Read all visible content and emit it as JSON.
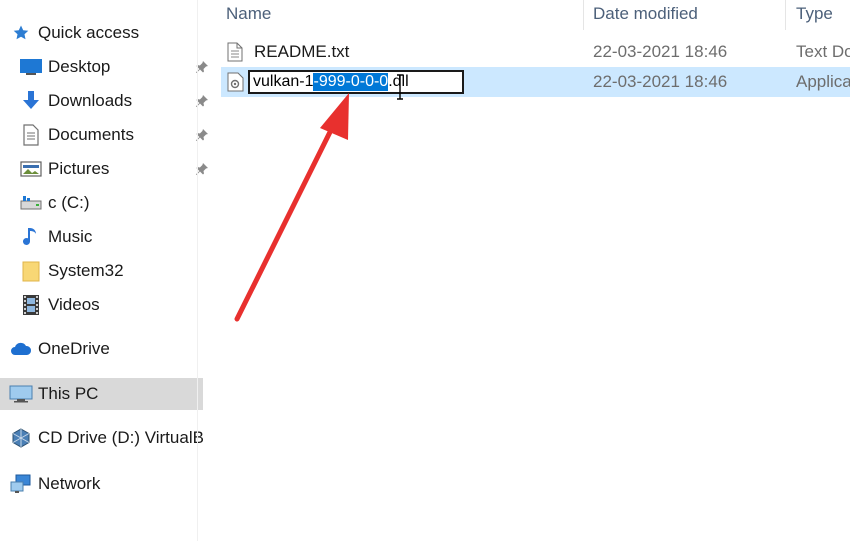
{
  "sidebar": {
    "quick_access": "Quick access",
    "items": [
      {
        "label": "Desktop"
      },
      {
        "label": "Downloads"
      },
      {
        "label": "Documents"
      },
      {
        "label": "Pictures"
      },
      {
        "label": "c (C:)"
      },
      {
        "label": "Music"
      },
      {
        "label": "System32"
      },
      {
        "label": "Videos"
      }
    ],
    "onedrive": "OneDrive",
    "this_pc": "This PC",
    "cd_drive": "CD Drive (D:) VirtualB",
    "network": "Network"
  },
  "columns": {
    "name": "Name",
    "date_modified": "Date modified",
    "type": "Type"
  },
  "files": [
    {
      "name": "README.txt",
      "date": "22-03-2021 18:46",
      "type": "Text Do"
    },
    {
      "name_before": "vulkan-1",
      "name_selected": "-999-0-0-0",
      "name_after": ".dll",
      "date": "22-03-2021 18:46",
      "type": "Applica"
    }
  ],
  "colors": {
    "accent": "#0078d7",
    "row_selected": "#cce8ff",
    "nav_selected": "#d9d9d9",
    "annotation_arrow": "#e8302e"
  }
}
